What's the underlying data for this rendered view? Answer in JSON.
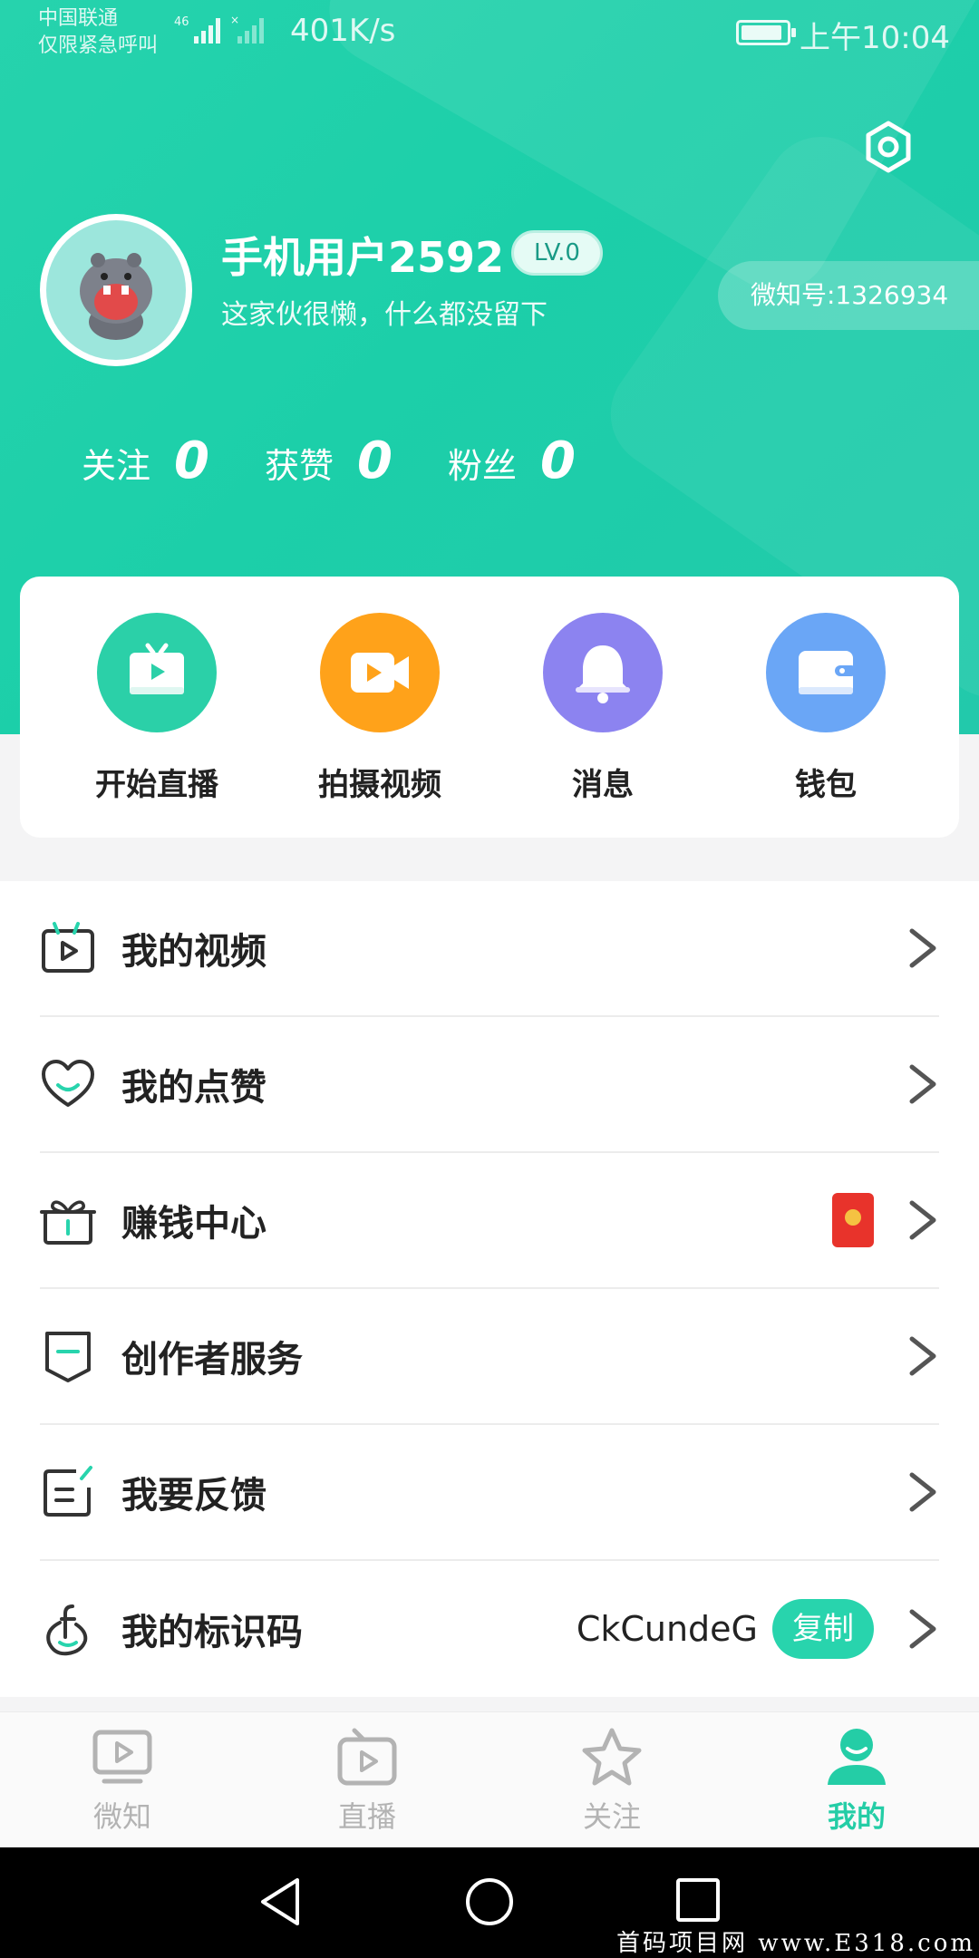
{
  "status_bar": {
    "carrier_line1": "中国联通",
    "carrier_line2": "仅限紧急呼叫",
    "network_badge": "46",
    "net_speed": "401K/s",
    "time": "上午10:04"
  },
  "profile": {
    "username": "手机用户2592",
    "level": "LV.0",
    "bio": "这家伙很懒，什么都没留下",
    "weizhi_id": "微知号:1326934",
    "stats": [
      {
        "label": "关注",
        "value": "0"
      },
      {
        "label": "获赞",
        "value": "0"
      },
      {
        "label": "粉丝",
        "value": "0"
      }
    ]
  },
  "quick_actions": [
    {
      "label": "开始直播",
      "icon": "tv-play-icon",
      "color": "#2bd0a8"
    },
    {
      "label": "拍摄视频",
      "icon": "video-camera-icon",
      "color": "#ffa21a"
    },
    {
      "label": "消息",
      "icon": "bell-icon",
      "color": "#8c83f0"
    },
    {
      "label": "钱包",
      "icon": "wallet-icon",
      "color": "#6aa6f6"
    }
  ],
  "menu": [
    {
      "label": "我的视频",
      "icon": "video-calendar-icon"
    },
    {
      "label": "我的点赞",
      "icon": "heart-icon"
    },
    {
      "label": "赚钱中心",
      "icon": "gift-box-icon"
    },
    {
      "label": "创作者服务",
      "icon": "shield-badge-icon"
    },
    {
      "label": "我要反馈",
      "icon": "feedback-note-icon"
    },
    {
      "label": "我的标识码",
      "icon": "identity-code-icon",
      "code": "CkCundeG",
      "copy_label": "复制"
    }
  ],
  "tabs": [
    {
      "label": "微知",
      "icon": "play-screen-icon",
      "active": false
    },
    {
      "label": "直播",
      "icon": "tv-icon",
      "active": false
    },
    {
      "label": "关注",
      "icon": "star-icon",
      "active": false
    },
    {
      "label": "我的",
      "icon": "user-icon",
      "active": true
    }
  ],
  "colors": {
    "accent": "#24cda6",
    "header_gradient_start": "#26d3ad",
    "header_gradient_end": "#22c9ab"
  },
  "watermark": "首码项目网 www.E318.com"
}
